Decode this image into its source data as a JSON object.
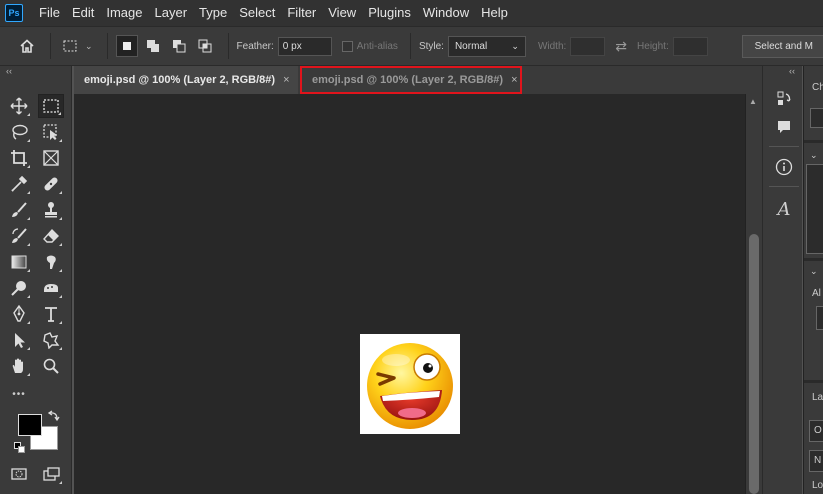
{
  "app": {
    "logo": "Ps"
  },
  "menu": [
    "File",
    "Edit",
    "Image",
    "Layer",
    "Type",
    "Select",
    "Filter",
    "View",
    "Plugins",
    "Window",
    "Help"
  ],
  "options": {
    "feather_label": "Feather:",
    "feather_value": "0 px",
    "anti_alias_label": "Anti-alias",
    "style_label": "Style:",
    "style_value": "Normal",
    "width_label": "Width:",
    "height_label": "Height:",
    "select_mask_label": "Select and M"
  },
  "tabs": [
    {
      "label": "emoji.psd @ 100% (Layer 2, RGB/8#)",
      "close": "×"
    },
    {
      "label": "emoji.psd @ 100% (Layer 2, RGB/8#)",
      "close": "×"
    }
  ],
  "toolbar": {
    "collapse": "‹‹",
    "more": "•••"
  },
  "panel": {
    "collapse": "‹‹",
    "char_icon": "A",
    "info_icon": "i",
    "right_labels": [
      "Ch",
      "Al",
      "La",
      "O",
      "N",
      "Lo"
    ]
  },
  "colors": {
    "accent_highlight": "#e0141c",
    "canvas": "#282828",
    "panel": "#3a3a3a",
    "menubar": "#323232"
  }
}
